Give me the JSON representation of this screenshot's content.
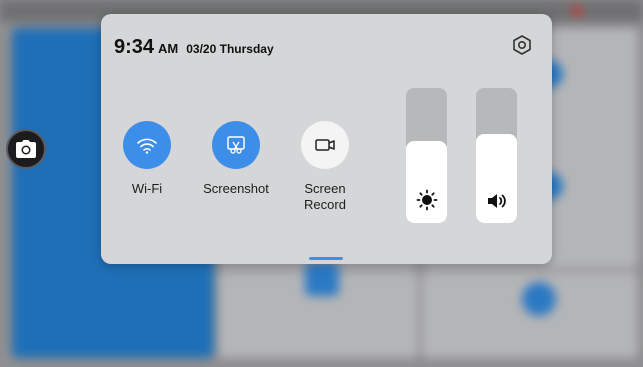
{
  "quick_panel": {
    "time": "9:34",
    "ampm": "AM",
    "date": "03/20 Thursday",
    "settings_icon": "settings-hexagon-icon",
    "tiles": [
      {
        "label": "Wi-Fi",
        "icon": "wifi-icon",
        "state": "on"
      },
      {
        "label": "Screenshot",
        "icon": "screenshot-icon",
        "state": "on"
      },
      {
        "label": "Screen\nRecord",
        "icon": "screen-record-icon",
        "state": "off"
      }
    ],
    "sliders": [
      {
        "name": "brightness",
        "icon": "brightness-icon",
        "level": 0.61
      },
      {
        "name": "volume",
        "icon": "volume-icon",
        "level": 0.66
      }
    ]
  },
  "colors": {
    "accent": "#3d8ee9",
    "panel": "#d5d6d7",
    "tile_off": "#f4f4f5"
  }
}
